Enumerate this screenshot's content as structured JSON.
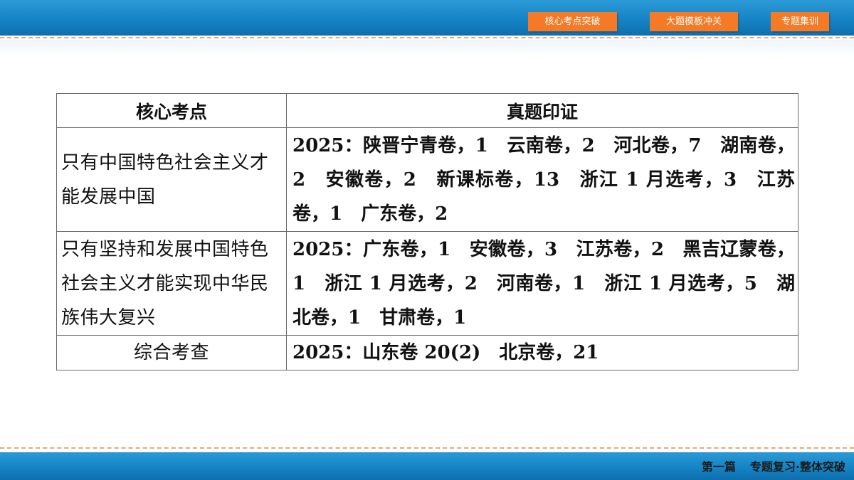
{
  "nav": {
    "buttons": [
      "核心考点突破",
      "大题模板冲关",
      "专题集训"
    ]
  },
  "table": {
    "headers": [
      "核心考点",
      "真题印证"
    ],
    "rows": [
      {
        "topic": "只有中国特色社会主义才能发展中国",
        "evidence": "2025：陕晋宁青卷，1　云南卷，2　河北卷，7　湖南卷，2　安徽卷，2　新课标卷，13　浙江 1 月选考，3　江苏卷，1　广东卷，2"
      },
      {
        "topic": "只有坚持和发展中国特色社会主义才能实现中华民族伟大复兴",
        "evidence": "2025：广东卷，1　安徽卷，3　江苏卷，2　黑吉辽蒙卷，1　浙江 1 月选考，2　河南卷，1　浙江 1 月选考，5　湖北卷，1　甘肃卷，1"
      },
      {
        "topic": "综合考查",
        "evidence": "2025：山东卷 20(2)　北京卷，21"
      }
    ]
  },
  "footer": {
    "part": "第一篇",
    "title": "专题复习·整体突破"
  },
  "colors": {
    "bar_blue": "#1584c6",
    "button_orange": "#f47a26",
    "dash_orange": "#f0a472"
  }
}
